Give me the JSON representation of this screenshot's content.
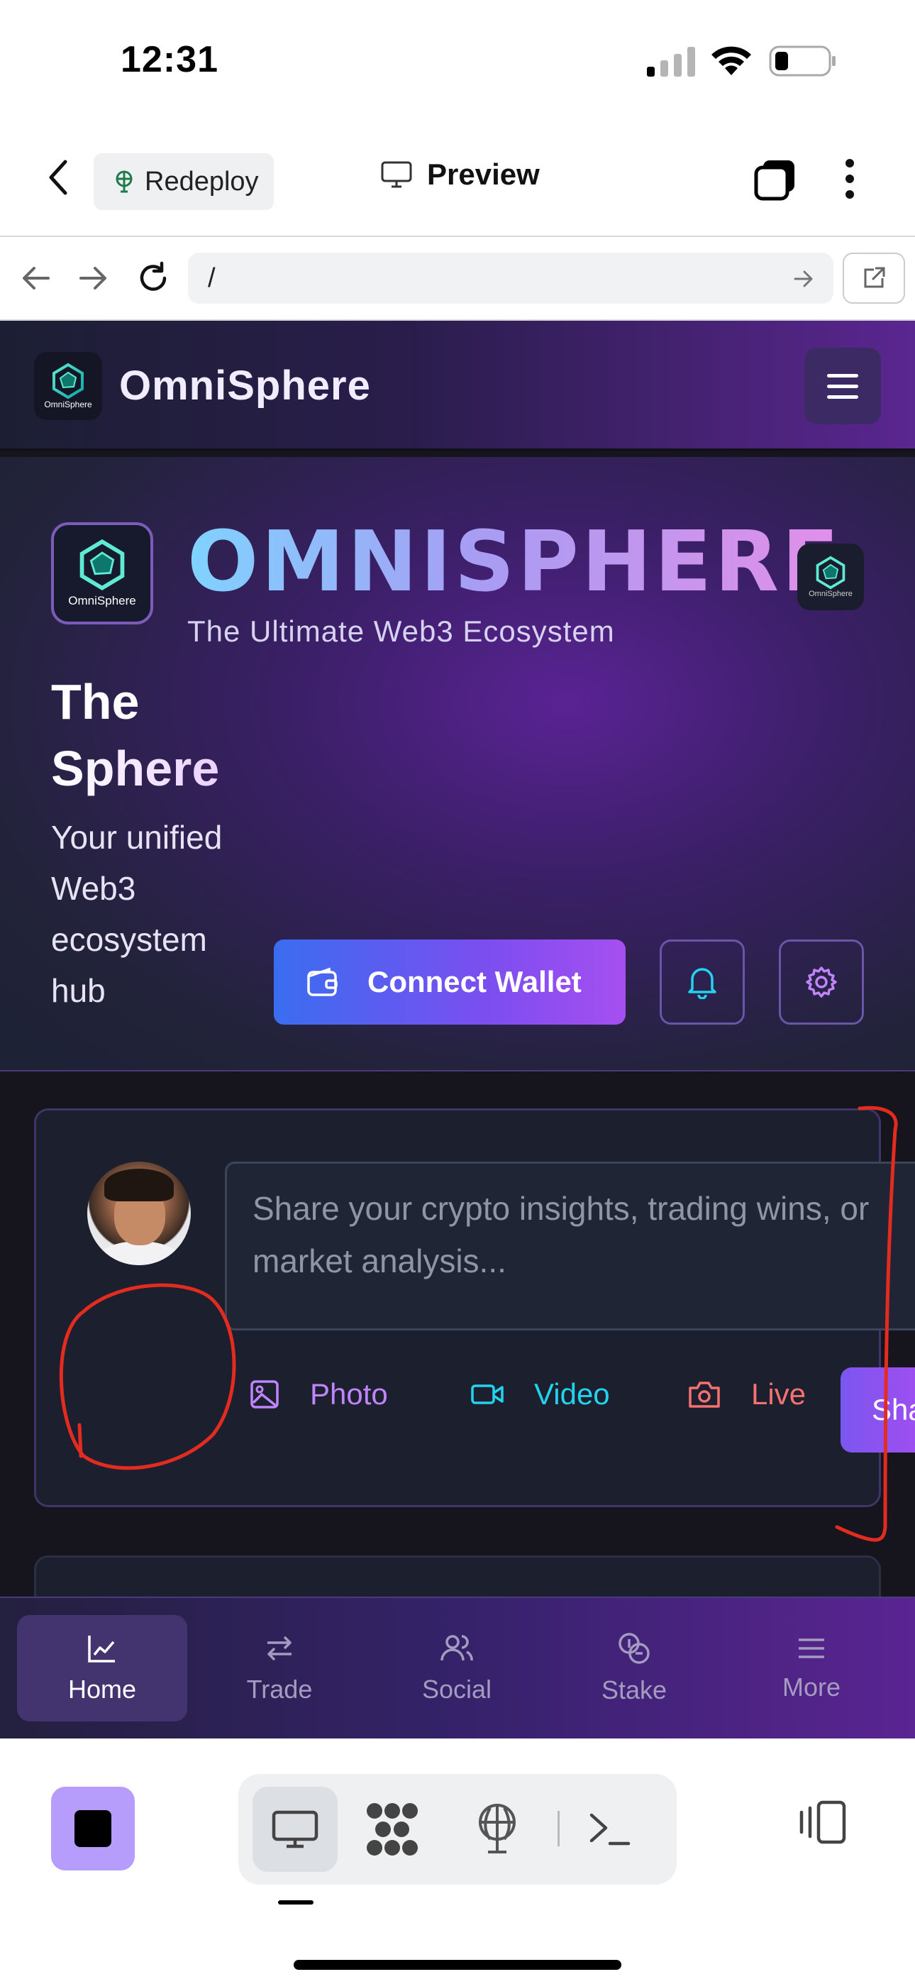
{
  "status_bar": {
    "time": "12:31"
  },
  "top_bar": {
    "redeploy_label": "Redeploy",
    "preview_label": "Preview"
  },
  "browser": {
    "url": "/"
  },
  "app": {
    "brand": "OmniSphere",
    "logo_caption": "OmniSphere",
    "hero": {
      "title": "OMNISPHERE",
      "subtitle": "The Ultimate Web3 Ecosystem",
      "section_title_line1": "The",
      "section_title_line2": "Sphere",
      "description": "Your unified Web3 ecosystem hub",
      "connect_wallet_label": "Connect Wallet"
    },
    "composer": {
      "placeholder": "Share your crypto insights, trading wins, or market analysis...",
      "actions": [
        {
          "label": "Photo",
          "icon": "image-icon",
          "color": "#c084fc"
        },
        {
          "label": "Video",
          "icon": "video-icon",
          "color": "#22d3ee"
        },
        {
          "label": "Live",
          "icon": "camera-icon",
          "color": "#f87171"
        }
      ],
      "share_label": "Share"
    },
    "bottom_nav": [
      {
        "label": "Home",
        "icon": "chart-line-icon",
        "active": true
      },
      {
        "label": "Trade",
        "icon": "arrows-swap-icon",
        "active": false
      },
      {
        "label": "Social",
        "icon": "users-icon",
        "active": false
      },
      {
        "label": "Stake",
        "icon": "coins-icon",
        "active": false
      },
      {
        "label": "More",
        "icon": "menu-icon",
        "active": false
      }
    ]
  },
  "colors": {
    "accent_purple": "#7b4ef0",
    "accent_blue": "#3a6df0",
    "annotation_red": "#e32b1f"
  }
}
